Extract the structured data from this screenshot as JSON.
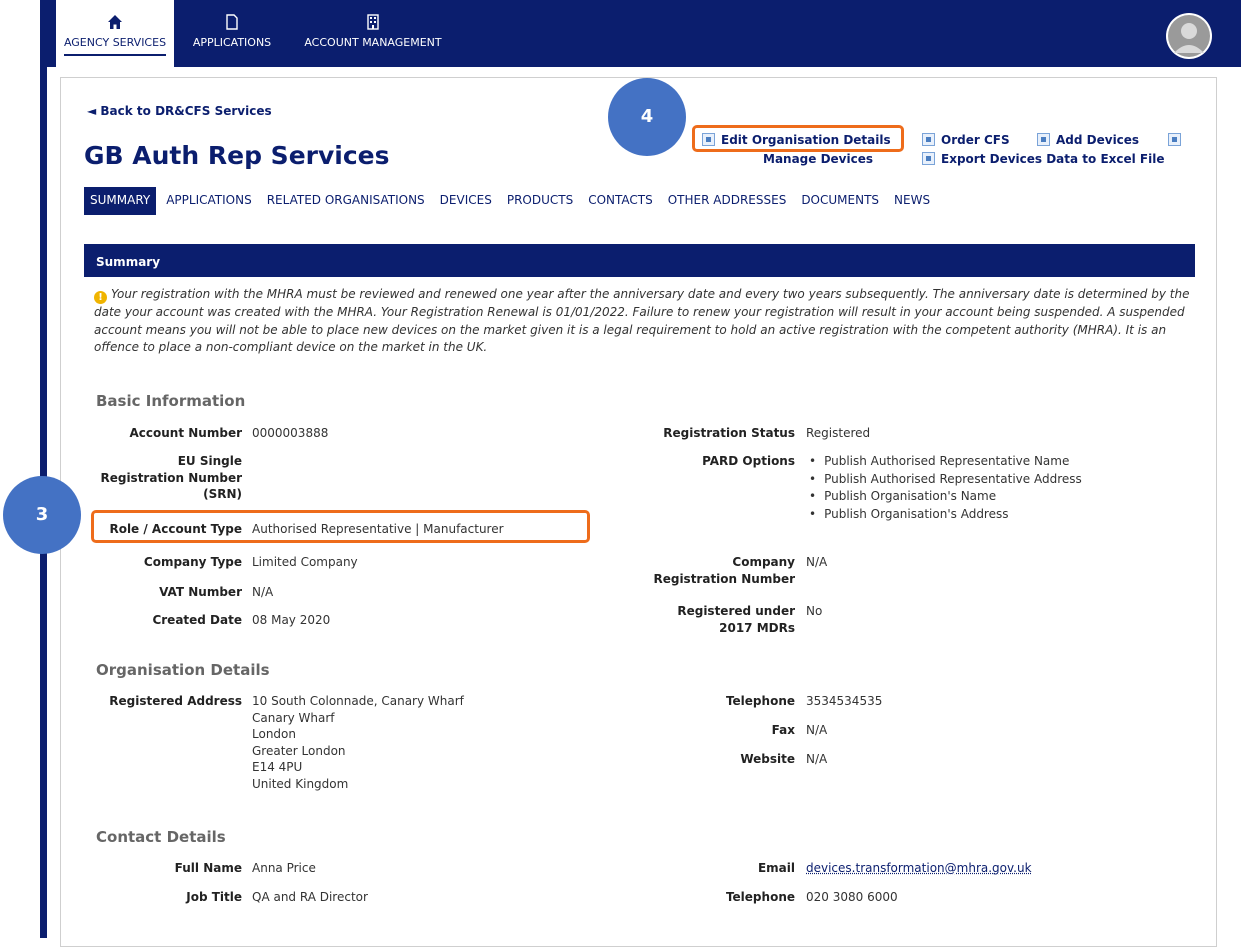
{
  "nav": {
    "tabs": [
      {
        "label": "AGENCY SERVICES",
        "icon": "home-icon"
      },
      {
        "label": "APPLICATIONS",
        "icon": "document-icon"
      },
      {
        "label": "ACCOUNT MANAGEMENT",
        "icon": "building-icon"
      }
    ]
  },
  "back_link": "◄ Back to DR&CFS Services",
  "page_title": "GB Auth Rep Services",
  "actions": {
    "edit": "Edit Organisation Details",
    "order_cfs": "Order CFS",
    "add_devices": "Add Devices",
    "manage_devices": "Manage Devices",
    "export": "Export Devices Data to Excel File"
  },
  "tabs": [
    "SUMMARY",
    "APPLICATIONS",
    "RELATED ORGANISATIONS",
    "DEVICES",
    "PRODUCTS",
    "CONTACTS",
    "OTHER ADDRESSES",
    "DOCUMENTS",
    "NEWS"
  ],
  "summary_header": "Summary",
  "notice": "Your registration with the MHRA must be reviewed and renewed one year after the anniversary date and every two years subsequently. The anniversary date is determined by the date your account was created with the MHRA. Your Registration Renewal is 01/01/2022. Failure to renew your registration will result in your account being suspended. A suspended account means you will not be able to place new devices on the market given it is a legal requirement to hold an active registration with the competent authority (MHRA). It is an offence to place a non-compliant device on the market in the UK.",
  "basic": {
    "heading": "Basic Information",
    "account_number_label": "Account Number",
    "account_number": "0000003888",
    "srn_label_1": "EU Single",
    "srn_label_2": "Registration Number",
    "srn_label_3": "(SRN)",
    "role_label": "Role / Account Type",
    "role": "Authorised Representative | Manufacturer",
    "company_type_label": "Company Type",
    "company_type": "Limited Company",
    "vat_label": "VAT Number",
    "vat": "N/A",
    "created_label": "Created Date",
    "created": "08 May 2020",
    "reg_status_label": "Registration Status",
    "reg_status": "Registered",
    "pard_label": "PARD Options",
    "pard": [
      "Publish Authorised Representative Name",
      "Publish Authorised Representative Address",
      "Publish Organisation's Name",
      "Publish Organisation's Address"
    ],
    "company_reg_label_1": "Company",
    "company_reg_label_2": "Registration Number",
    "company_reg": "N/A",
    "mdr_label_1": "Registered under",
    "mdr_label_2": "2017 MDRs",
    "mdr": "No"
  },
  "org": {
    "heading": "Organisation Details",
    "address_label": "Registered Address",
    "address": [
      "10 South Colonnade, Canary Wharf",
      "Canary Wharf",
      "London",
      "Greater London",
      "E14 4PU",
      "United Kingdom"
    ],
    "telephone_label": "Telephone",
    "telephone": "3534534535",
    "fax_label": "Fax",
    "fax": "N/A",
    "website_label": "Website",
    "website": "N/A"
  },
  "contact": {
    "heading": "Contact Details",
    "name_label": "Full Name",
    "name": "Anna Price",
    "job_label": "Job Title",
    "job": "QA and RA Director",
    "email_label": "Email",
    "email": "devices.transformation@mhra.gov.uk",
    "telephone_label": "Telephone",
    "telephone": "020 3080 6000"
  },
  "callouts": {
    "step3": "3",
    "step4": "4"
  },
  "colors": {
    "brand": "#0b1e6e",
    "highlight": "#ee6c1b",
    "callout": "#4472c4"
  }
}
